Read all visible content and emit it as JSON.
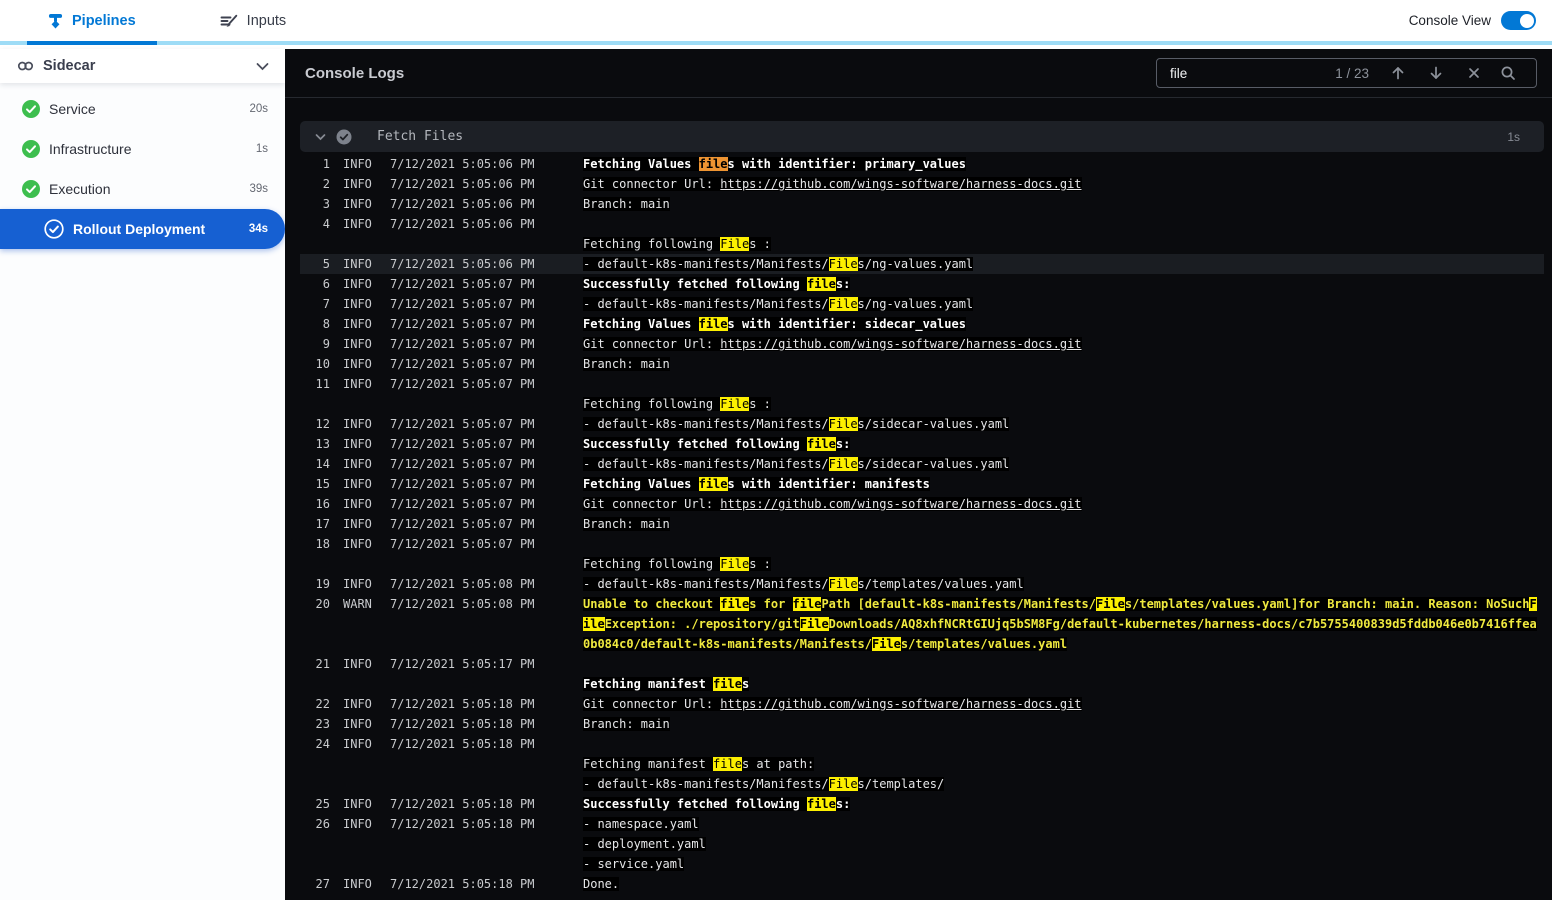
{
  "top_nav": {
    "tabs": [
      {
        "label": "Pipelines",
        "active": true
      },
      {
        "label": "Inputs",
        "active": false
      }
    ],
    "console_view_label": "Console View",
    "console_view_on": true
  },
  "sidebar": {
    "stage": {
      "label": "Sidecar"
    },
    "items": [
      {
        "label": "Service",
        "duration": "20s",
        "status": "success",
        "selected": false,
        "child": false
      },
      {
        "label": "Infrastructure",
        "duration": "1s",
        "status": "success",
        "selected": false,
        "child": false
      },
      {
        "label": "Execution",
        "duration": "39s",
        "status": "success",
        "selected": false,
        "child": false
      },
      {
        "label": "Rollout Deployment",
        "duration": "34s",
        "status": "success",
        "selected": true,
        "child": true
      }
    ]
  },
  "console": {
    "title": "Console Logs",
    "search": {
      "value": "file",
      "count": "1 / 23"
    },
    "section": {
      "title": "Fetch Files",
      "duration": "1s",
      "status": "success"
    },
    "rows": [
      {
        "n": "1",
        "lvl": "INFO",
        "ts": "7/12/2021 5:05:06 PM",
        "seg": [
          {
            "t": "Fetching Values ",
            "s": "b"
          },
          {
            "t": "file",
            "s": "b",
            "h": "o"
          },
          {
            "t": "s with identifier: primary_values",
            "s": "b"
          }
        ]
      },
      {
        "n": "2",
        "lvl": "INFO",
        "ts": "7/12/2021 5:05:06 PM",
        "seg": [
          {
            "t": "Git connector Url: ",
            "s": "p"
          },
          {
            "t": "https://github.com/wings-software/harness-docs.git",
            "s": "l"
          }
        ]
      },
      {
        "n": "3",
        "lvl": "INFO",
        "ts": "7/12/2021 5:05:06 PM",
        "seg": [
          {
            "t": "Branch: main",
            "s": "p"
          }
        ]
      },
      {
        "n": "4",
        "lvl": "INFO",
        "ts": "7/12/2021 5:05:06 PM",
        "seg": []
      },
      {
        "n": "",
        "lvl": "",
        "ts": "",
        "seg": [
          {
            "t": "Fetching following ",
            "s": "p"
          },
          {
            "t": "File",
            "s": "p",
            "h": "y"
          },
          {
            "t": "s :",
            "s": "p"
          }
        ]
      },
      {
        "n": "5",
        "lvl": "INFO",
        "ts": "7/12/2021 5:05:06 PM",
        "active": true,
        "seg": [
          {
            "t": "- default-k8s-manifests/Manifests/",
            "s": "p"
          },
          {
            "t": "File",
            "s": "p",
            "h": "y"
          },
          {
            "t": "s/ng-values.yaml",
            "s": "p"
          }
        ]
      },
      {
        "n": "6",
        "lvl": "INFO",
        "ts": "7/12/2021 5:05:07 PM",
        "seg": [
          {
            "t": "Successfully fetched following ",
            "s": "b"
          },
          {
            "t": "file",
            "s": "b",
            "h": "y"
          },
          {
            "t": "s:",
            "s": "b"
          }
        ]
      },
      {
        "n": "7",
        "lvl": "INFO",
        "ts": "7/12/2021 5:05:07 PM",
        "seg": [
          {
            "t": "- default-k8s-manifests/Manifests/",
            "s": "p"
          },
          {
            "t": "File",
            "s": "p",
            "h": "y"
          },
          {
            "t": "s/ng-values.yaml",
            "s": "p"
          }
        ]
      },
      {
        "n": "8",
        "lvl": "INFO",
        "ts": "7/12/2021 5:05:07 PM",
        "seg": [
          {
            "t": "Fetching Values ",
            "s": "b"
          },
          {
            "t": "file",
            "s": "b",
            "h": "y"
          },
          {
            "t": "s with identifier: sidecar_values",
            "s": "b"
          }
        ]
      },
      {
        "n": "9",
        "lvl": "INFO",
        "ts": "7/12/2021 5:05:07 PM",
        "seg": [
          {
            "t": "Git connector Url: ",
            "s": "p"
          },
          {
            "t": "https://github.com/wings-software/harness-docs.git",
            "s": "l"
          }
        ]
      },
      {
        "n": "10",
        "lvl": "INFO",
        "ts": "7/12/2021 5:05:07 PM",
        "seg": [
          {
            "t": "Branch: main",
            "s": "p"
          }
        ]
      },
      {
        "n": "11",
        "lvl": "INFO",
        "ts": "7/12/2021 5:05:07 PM",
        "seg": []
      },
      {
        "n": "",
        "lvl": "",
        "ts": "",
        "seg": [
          {
            "t": "Fetching following ",
            "s": "p"
          },
          {
            "t": "File",
            "s": "p",
            "h": "y"
          },
          {
            "t": "s :",
            "s": "p"
          }
        ]
      },
      {
        "n": "12",
        "lvl": "INFO",
        "ts": "7/12/2021 5:05:07 PM",
        "seg": [
          {
            "t": "- default-k8s-manifests/Manifests/",
            "s": "p"
          },
          {
            "t": "File",
            "s": "p",
            "h": "y"
          },
          {
            "t": "s/sidecar-values.yaml",
            "s": "p"
          }
        ]
      },
      {
        "n": "13",
        "lvl": "INFO",
        "ts": "7/12/2021 5:05:07 PM",
        "seg": [
          {
            "t": "Successfully fetched following ",
            "s": "b"
          },
          {
            "t": "file",
            "s": "b",
            "h": "y"
          },
          {
            "t": "s:",
            "s": "b"
          }
        ]
      },
      {
        "n": "14",
        "lvl": "INFO",
        "ts": "7/12/2021 5:05:07 PM",
        "seg": [
          {
            "t": "- default-k8s-manifests/Manifests/",
            "s": "p"
          },
          {
            "t": "File",
            "s": "p",
            "h": "y"
          },
          {
            "t": "s/sidecar-values.yaml",
            "s": "p"
          }
        ]
      },
      {
        "n": "15",
        "lvl": "INFO",
        "ts": "7/12/2021 5:05:07 PM",
        "seg": [
          {
            "t": "Fetching Values ",
            "s": "b"
          },
          {
            "t": "file",
            "s": "b",
            "h": "y"
          },
          {
            "t": "s with identifier: manifests",
            "s": "b"
          }
        ]
      },
      {
        "n": "16",
        "lvl": "INFO",
        "ts": "7/12/2021 5:05:07 PM",
        "seg": [
          {
            "t": "Git connector Url: ",
            "s": "p"
          },
          {
            "t": "https://github.com/wings-software/harness-docs.git",
            "s": "l"
          }
        ]
      },
      {
        "n": "17",
        "lvl": "INFO",
        "ts": "7/12/2021 5:05:07 PM",
        "seg": [
          {
            "t": "Branch: main",
            "s": "p"
          }
        ]
      },
      {
        "n": "18",
        "lvl": "INFO",
        "ts": "7/12/2021 5:05:07 PM",
        "seg": []
      },
      {
        "n": "",
        "lvl": "",
        "ts": "",
        "seg": [
          {
            "t": "Fetching following ",
            "s": "p"
          },
          {
            "t": "File",
            "s": "p",
            "h": "y"
          },
          {
            "t": "s :",
            "s": "p"
          }
        ]
      },
      {
        "n": "19",
        "lvl": "INFO",
        "ts": "7/12/2021 5:05:08 PM",
        "seg": [
          {
            "t": "- default-k8s-manifests/Manifests/",
            "s": "p"
          },
          {
            "t": "File",
            "s": "p",
            "h": "y"
          },
          {
            "t": "s/templates/values.yaml",
            "s": "p"
          }
        ]
      },
      {
        "n": "20",
        "lvl": "WARN",
        "ts": "7/12/2021 5:05:08 PM",
        "seg": [
          {
            "t": "Unable to checkout ",
            "s": "w"
          },
          {
            "t": "file",
            "s": "w",
            "h": "y"
          },
          {
            "t": "s for ",
            "s": "w"
          },
          {
            "t": "file",
            "s": "w",
            "h": "y"
          },
          {
            "t": "Path [default-k8s-manifests/Manifests/",
            "s": "w"
          },
          {
            "t": "File",
            "s": "w",
            "h": "y"
          },
          {
            "t": "s/templates/values.yaml]for Branch: main. Reason: NoSuch",
            "s": "w"
          },
          {
            "t": "F",
            "s": "w",
            "h": "y"
          }
        ]
      },
      {
        "n": "",
        "lvl": "",
        "ts": "",
        "seg": [
          {
            "t": "ile",
            "s": "w",
            "h": "y"
          },
          {
            "t": "Exception: ./repository/git",
            "s": "w"
          },
          {
            "t": "File",
            "s": "w",
            "h": "y"
          },
          {
            "t": "Downloads/AQ8xhfNCRtGIUjq5bSM8Fg/default-kubernetes/harness-docs/c7b5755400839d5fddb046e0b7416ffea",
            "s": "w"
          }
        ]
      },
      {
        "n": "",
        "lvl": "",
        "ts": "",
        "seg": [
          {
            "t": "0b084c0/default-k8s-manifests/Manifests/",
            "s": "w"
          },
          {
            "t": "File",
            "s": "w",
            "h": "y"
          },
          {
            "t": "s/templates/values.yaml",
            "s": "w"
          }
        ]
      },
      {
        "n": "21",
        "lvl": "INFO",
        "ts": "7/12/2021 5:05:17 PM",
        "seg": []
      },
      {
        "n": "",
        "lvl": "",
        "ts": "",
        "seg": [
          {
            "t": "Fetching manifest ",
            "s": "b"
          },
          {
            "t": "file",
            "s": "b",
            "h": "y"
          },
          {
            "t": "s",
            "s": "b"
          }
        ]
      },
      {
        "n": "22",
        "lvl": "INFO",
        "ts": "7/12/2021 5:05:18 PM",
        "seg": [
          {
            "t": "Git connector Url: ",
            "s": "p"
          },
          {
            "t": "https://github.com/wings-software/harness-docs.git",
            "s": "l"
          }
        ]
      },
      {
        "n": "23",
        "lvl": "INFO",
        "ts": "7/12/2021 5:05:18 PM",
        "seg": [
          {
            "t": "Branch: main",
            "s": "p"
          }
        ]
      },
      {
        "n": "24",
        "lvl": "INFO",
        "ts": "7/12/2021 5:05:18 PM",
        "seg": []
      },
      {
        "n": "",
        "lvl": "",
        "ts": "",
        "seg": [
          {
            "t": "Fetching manifest ",
            "s": "p"
          },
          {
            "t": "file",
            "s": "p",
            "h": "y"
          },
          {
            "t": "s at path:",
            "s": "p"
          }
        ]
      },
      {
        "n": "",
        "lvl": "",
        "ts": "",
        "seg": [
          {
            "t": "- default-k8s-manifests/Manifests/",
            "s": "p"
          },
          {
            "t": "File",
            "s": "p",
            "h": "y"
          },
          {
            "t": "s/templates/",
            "s": "p"
          }
        ]
      },
      {
        "n": "25",
        "lvl": "INFO",
        "ts": "7/12/2021 5:05:18 PM",
        "seg": [
          {
            "t": "Successfully fetched following ",
            "s": "b"
          },
          {
            "t": "file",
            "s": "b",
            "h": "y"
          },
          {
            "t": "s:",
            "s": "b"
          }
        ]
      },
      {
        "n": "26",
        "lvl": "INFO",
        "ts": "7/12/2021 5:05:18 PM",
        "seg": [
          {
            "t": "- namespace.yaml",
            "s": "p"
          }
        ]
      },
      {
        "n": "",
        "lvl": "",
        "ts": "",
        "seg": [
          {
            "t": "- deployment.yaml",
            "s": "p"
          }
        ]
      },
      {
        "n": "",
        "lvl": "",
        "ts": "",
        "seg": [
          {
            "t": "- service.yaml",
            "s": "p"
          }
        ]
      },
      {
        "n": "27",
        "lvl": "INFO",
        "ts": "7/12/2021 5:05:18 PM",
        "seg": [
          {
            "t": "Done.",
            "s": "p"
          }
        ]
      }
    ]
  },
  "colors": {
    "accent_blue": "#0278d5",
    "selected_step_blue": "#1660d2",
    "success_green": "#3dbe4e",
    "warn_yellow": "#efe93f",
    "match_highlight": "#fdf000",
    "current_match_highlight": "#ee9432",
    "nav_underline_cyan": "#9edcf6"
  }
}
